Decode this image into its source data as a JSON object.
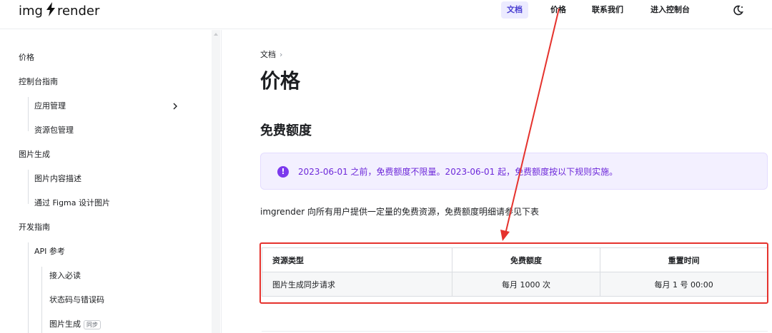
{
  "header": {
    "logo_left": "img",
    "logo_right": "render",
    "nav": [
      {
        "label": "文档",
        "active": true
      },
      {
        "label": "价格",
        "active": false
      },
      {
        "label": "联系我们",
        "active": false
      },
      {
        "label": "进入控制台",
        "active": false
      }
    ],
    "theme_toggle_icon": "moon-icon"
  },
  "sidebar": {
    "items": [
      {
        "label": "价格"
      },
      {
        "label": "控制台指南"
      },
      {
        "label": "应用管理",
        "expandable": true
      },
      {
        "label": "资源包管理"
      },
      {
        "label": "图片生成"
      },
      {
        "label": "图片内容描述"
      },
      {
        "label": "通过 Figma 设计图片"
      },
      {
        "label": "开发指南"
      },
      {
        "label": "API 参考"
      },
      {
        "label": "接入必读"
      },
      {
        "label": "状态码与错误码"
      },
      {
        "label": "图片生成",
        "tag": "同步"
      }
    ]
  },
  "main": {
    "breadcrumb": "文档",
    "title": "价格",
    "section_title": "免费额度",
    "callout_text": "2023-06-01 之前，免费额度不限量。2023-06-01 起，免费额度按以下规则实施。",
    "intro": "imgrender 向所有用户提供一定量的免费资源，免费额度明细请参见下表",
    "table": {
      "headers": [
        "资源类型",
        "免费额度",
        "重置时间"
      ],
      "rows": [
        [
          "图片生成同步请求",
          "每月 1000 次",
          "每月 1 号 00:00"
        ]
      ]
    }
  },
  "colors": {
    "accent": "#4a3fd1",
    "callout_bg": "#f3f0ff",
    "callout_text": "#6d28d9",
    "annotation_red": "#e5322d"
  }
}
